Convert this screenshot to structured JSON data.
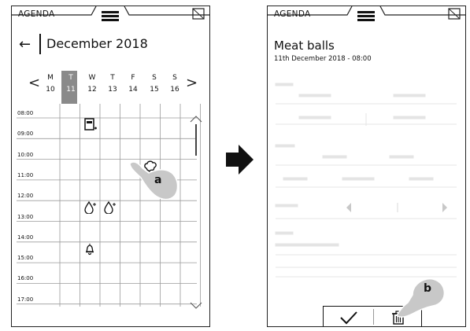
{
  "left_screen": {
    "app_title": "AGENDA",
    "back_arrow": "←",
    "month_title": "December 2018",
    "week_prev": "<",
    "week_next": ">",
    "days": [
      {
        "dow": "M",
        "num": "10"
      },
      {
        "dow": "T",
        "num": "11"
      },
      {
        "dow": "W",
        "num": "12"
      },
      {
        "dow": "T",
        "num": "13"
      },
      {
        "dow": "F",
        "num": "14"
      },
      {
        "dow": "S",
        "num": "15"
      },
      {
        "dow": "S",
        "num": "16"
      }
    ],
    "selected_day_index": 1,
    "times": [
      "08:00",
      "09:00",
      "10:00",
      "11:00",
      "12:00",
      "13:00",
      "14:00",
      "15:00",
      "16:00",
      "17:00"
    ],
    "events": [
      {
        "icon": "oven-icon",
        "day_index": 1,
        "time": "08:00"
      },
      {
        "icon": "chef-hat-icon",
        "day_index": 4,
        "time": "10:00"
      },
      {
        "icon": "steam-drop-icon",
        "day_index": 1,
        "time": "12:00"
      },
      {
        "icon": "steam-drop-icon",
        "day_index": 2,
        "time": "12:00"
      },
      {
        "icon": "bell-icon",
        "day_index": 1,
        "time": "14:00"
      }
    ],
    "callout": "a"
  },
  "right_screen": {
    "app_title": "AGENDA",
    "event_title": "Meat balls",
    "event_datetime": "11th December 2018 - 08:00",
    "callout": "b"
  },
  "colors": {
    "today_highlight": "#8a8a8a",
    "ink": "#111111",
    "hand_fill": "#c8c8c8"
  }
}
